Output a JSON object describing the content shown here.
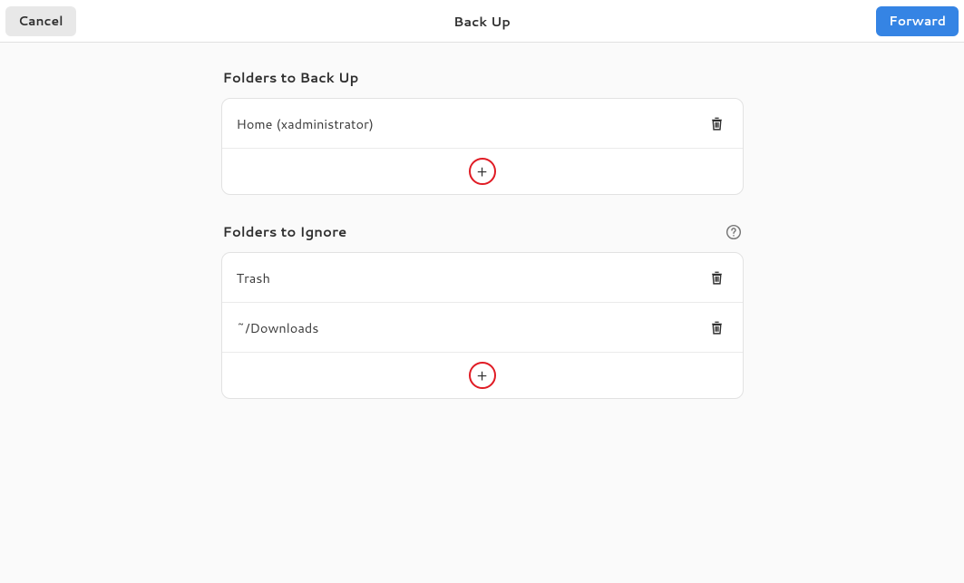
{
  "header": {
    "title": "Back Up",
    "cancel_label": "Cancel",
    "forward_label": "Forward"
  },
  "sections": {
    "backup": {
      "title": "Folders to Back Up",
      "items": [
        {
          "label": "Home (xadministrator)"
        }
      ]
    },
    "ignore": {
      "title": "Folders to Ignore",
      "items": [
        {
          "label": "Trash"
        },
        {
          "label": "~/Downloads"
        }
      ]
    }
  },
  "icons": {
    "add": "+"
  }
}
